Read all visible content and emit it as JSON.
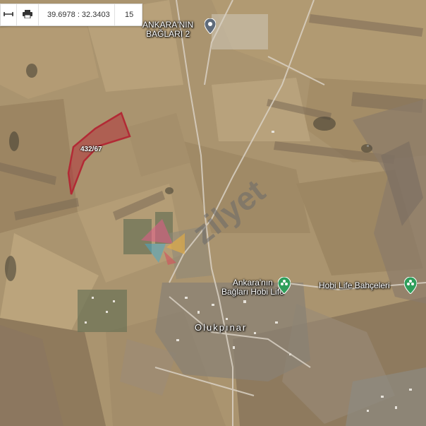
{
  "toolbar": {
    "measure_icon": "measure-icon",
    "print_icon": "printer-icon",
    "coordinates": "39.6978 : 32.3403",
    "zoom": "15"
  },
  "map": {
    "place_labels": {
      "bag2": "ANKARA'NIN\nBAĞLARI 2",
      "hobi_life": "Ankara'nın\nBağları Hobi Life",
      "hobi_bahce": "Hobi Life Bahçeleri",
      "town": "Olukpınar"
    },
    "parcel": {
      "label": "432/67",
      "color": "#b22a35"
    },
    "watermark": {
      "text": "zilyet",
      "color": "#6a6a6a"
    },
    "colors": {
      "pin_gray": "#5f6b7a",
      "pin_green": "#2e9e5b"
    }
  }
}
